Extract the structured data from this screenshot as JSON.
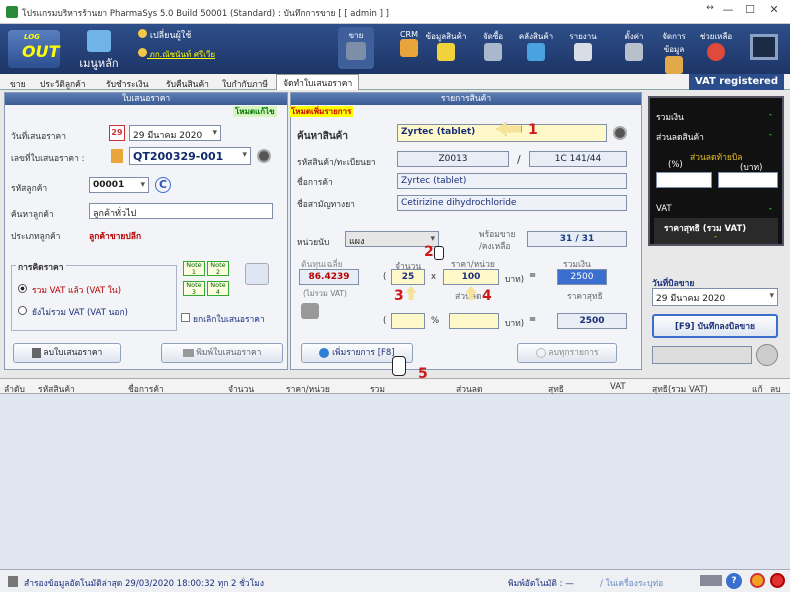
{
  "window": {
    "title": "โปรแกรมบริหารร้านยา PharmaSys 5.0 Build 50001 (Standard) : บันทึกการขาย [ [ admin ] ]",
    "min": "—",
    "max": "☐",
    "close": "✕",
    "resize": "↔"
  },
  "toolbar": {
    "logout": "OUT",
    "logout_small": "LOG",
    "home": "เมนูหลัก",
    "change_user": "เปลี่ยนผู้ใช้",
    "user_name": "ภก.ณัชนันท์ ศรีเวีย",
    "sell": "ขาย",
    "crm": "CRM",
    "product_info": "ข้อมูลสินค้า",
    "buy": "จัดซื้อ",
    "stock": "คลังสินค้า",
    "report": "รายงาน",
    "settings": "ตั้งค่า",
    "manage": "จัดการข้อมูล",
    "help": "ช่วยเหลือ"
  },
  "tabs": [
    "ขาย",
    "ประวัติลูกค้า",
    "รับชำระเงิน",
    "รับคืนสินค้า",
    "ใบกำกับภาษี",
    "จัดทำใบเสนอราคา"
  ],
  "vat_registered": "VAT registered",
  "quote": {
    "header": "ใบเสนอราคา",
    "edit_mode": "โหมดแก้ไข",
    "add_mode": "โหมดเพิ่มรายการ",
    "date_label": "วันที่เสนอราคา",
    "cal_day": "29",
    "date_value": "29  มีนาคม  2020",
    "no_label": "เลขที่ใบเสนอราคา :",
    "no_value": "QT200329-001",
    "cust_code_label": "รหัสลูกค้า",
    "cust_code": "00001",
    "cust_c": "C",
    "search_cust_label": "ค้นหาลูกค้า",
    "search_cust": "ลูกค้าทั่วไป",
    "cust_type_label": "ประเภทลูกค้า",
    "cust_type": "ลูกค้าขายปลีก",
    "pricing_label": "การคิดราคา",
    "vat_incl": "รวม VAT แล้ว (VAT ใน)",
    "vat_excl": "ยังไม่รวม VAT (VAT นอก)",
    "notes": [
      "Note 1",
      "Note 2",
      "Note 3",
      "Note 4"
    ],
    "cancel_quote": "ยกเลิกใบเสนอราคา",
    "delete_btn": "ลบใบเสนอราคา",
    "print_btn": "พิมพ์ใบเสนอราคา"
  },
  "items": {
    "header": "รายการสินค้า",
    "search_label": "ค้นหาสินค้า",
    "search_value": "Zyrtec (tablet)",
    "code_label": "รหัสสินค้า/ทะเบียนยา",
    "code": "Z0013",
    "sep": "/",
    "reg": "1C 141/44",
    "name_label": "ชื่อการค้า",
    "name": "Zyrtec (tablet)",
    "generic_label": "ชื่อสามัญทางยา",
    "generic": "Cetirizine dihydrochloride",
    "unit_label": "หน่วยนับ",
    "unit": "แผง",
    "ready_label": "พร้อมขาย",
    "remaining_label": "/คงเหลือ",
    "stock": "31 / 31",
    "avgcost_label": "ต้นทุนเฉลี่ย",
    "avgcost": "86.4239",
    "novat": "(ไม่รวม VAT)",
    "qty_label": "จำนวน",
    "price_label": "ราคา/หน่วย",
    "sum_label": "รวมเงิน",
    "qty": "25",
    "x": "x",
    "price": "100",
    "baht": "บาท)",
    "eq": "=",
    "sum": "2500",
    "open_paren": "(",
    "discount_label": "ส่วนลด",
    "net_label": "ราคาสุทธิ",
    "pct": "%",
    "net": "2500",
    "add_btn": "เพิ่มรายการ [F8]",
    "del_item_btn": "ลบทุกรายการ"
  },
  "markers": {
    "m1": "1",
    "m2": "2",
    "m3": "3",
    "m4": "4",
    "m5": "5"
  },
  "summary": {
    "total_label": "รวมเงิน",
    "total": "-",
    "disc_label": "ส่วนลดสินค้า",
    "disc": "-",
    "bill_disc_label": "ส่วนลดท้ายบิล",
    "pct_label": "(%)",
    "baht_label": "(บาท)",
    "vat_label": "VAT",
    "vat": "-",
    "net_label": "ราคาสุทธิ (รวม VAT)",
    "net": "-",
    "date_label": "วันที่บิลขาย",
    "date": "29  มีนาคม  2020",
    "save_btn": "[F9] บันทึกลงบิลขาย"
  },
  "table": {
    "columns": [
      "ลำดับ",
      "รหัสสินค้า",
      "ชื่อการค้า",
      "จำนวน",
      "ราคา/หน่วย",
      "รวม",
      "ส่วนลด",
      "สุทธิ",
      "VAT",
      "สุทธิ(รวม VAT)",
      "แก้",
      "ลบ"
    ]
  },
  "status": {
    "backup": "สำรองข้อมูลอัตโนมัติล่าสุด  29/03/2020 18:00:32  ทุก 2 ชั่วโมง",
    "printer_label": "พิมพ์อัตโนมัติ : —",
    "printer_state": "/ ในเครื่องระบุท่อ"
  },
  "colors": {
    "toolbar": "#1d3567",
    "accent": "#2b4d8a",
    "highlight": "#fff3b0"
  }
}
